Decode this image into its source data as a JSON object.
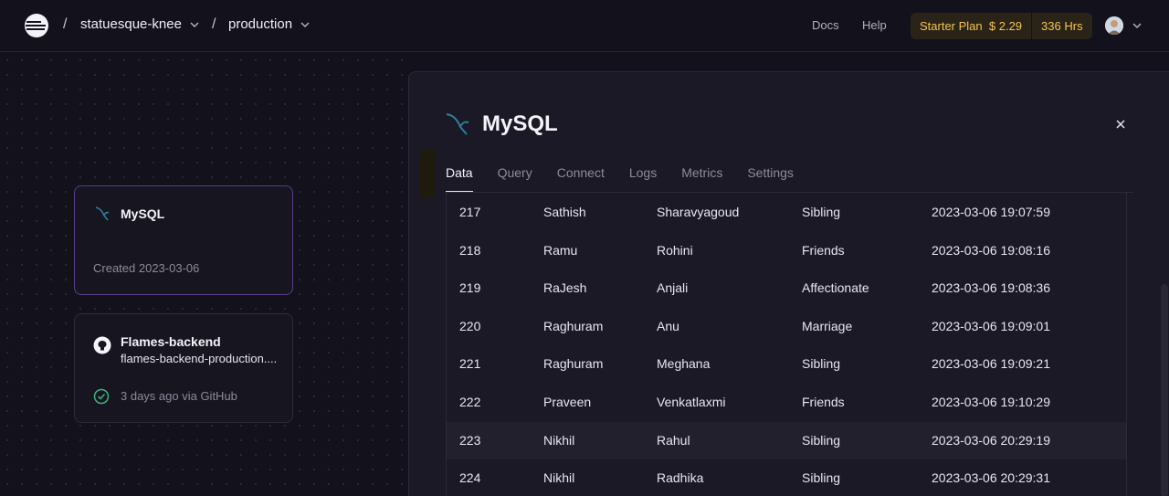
{
  "header": {
    "project": "statuesque-knee",
    "environment": "production",
    "links": [
      "Docs",
      "Help"
    ],
    "plan": {
      "name": "Starter Plan",
      "cost": "$ 2.29",
      "hours": "336 Hrs"
    }
  },
  "canvas": {
    "db_card": {
      "title": "MySQL",
      "created": "Created 2023-03-06"
    },
    "service_card": {
      "title": "Flames-backend",
      "domain": "flames-backend-production....",
      "deploy": "3 days ago via GitHub"
    }
  },
  "panel": {
    "title": "MySQL",
    "tabs": [
      "Data",
      "Query",
      "Connect",
      "Logs",
      "Metrics",
      "Settings"
    ],
    "active_tab": "Data",
    "rows": [
      [
        "217",
        "Sathish",
        "Sharavyagoud",
        "Sibling",
        "2023-03-06 19:07:59"
      ],
      [
        "218",
        "Ramu",
        "Rohini",
        "Friends",
        "2023-03-06 19:08:16"
      ],
      [
        "219",
        "RaJesh",
        "Anjali",
        "Affectionate",
        "2023-03-06 19:08:36"
      ],
      [
        "220",
        "Raghuram",
        "Anu",
        "Marriage",
        "2023-03-06 19:09:01"
      ],
      [
        "221",
        "Raghuram",
        "Meghana",
        "Sibling",
        "2023-03-06 19:09:21"
      ],
      [
        "222",
        "Praveen",
        "Venkatlaxmi",
        "Friends",
        "2023-03-06 19:10:29"
      ],
      [
        "223",
        "Nikhil",
        "Rahul",
        "Sibling",
        "2023-03-06 20:29:19"
      ],
      [
        "224",
        "Nikhil",
        "Radhika",
        "Sibling",
        "2023-03-06 20:29:31"
      ]
    ],
    "highlighted_row": "223"
  },
  "colors": {
    "background": "#13111c",
    "panel": "#1b1925",
    "plan_text": "#f5c451",
    "selected_border": "#5a3d8c",
    "success": "#3fb37f"
  },
  "icons": [
    "app-logo-icon",
    "chevron-down-icon",
    "mysql-dolphin-icon",
    "github-icon",
    "check-circle-icon",
    "close-icon"
  ]
}
